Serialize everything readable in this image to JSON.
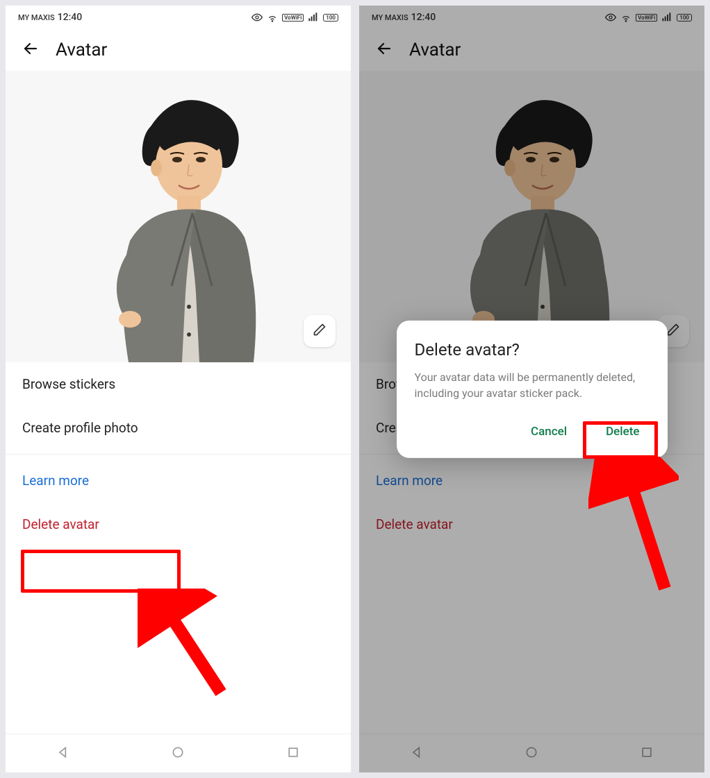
{
  "statusbar": {
    "carrier": "MY MAXIS",
    "time": "12:40",
    "battery": "100"
  },
  "header": {
    "title": "Avatar"
  },
  "options": {
    "browse_stickers": "Browse stickers",
    "create_profile_photo": "Create profile photo",
    "learn_more": "Learn more",
    "delete_avatar": "Delete avatar"
  },
  "dialog": {
    "title": "Delete avatar?",
    "body": "Your avatar data will be permanently deleted, including your avatar sticker pack.",
    "cancel": "Cancel",
    "confirm": "Delete"
  },
  "icons": {
    "vowifi": "VoWiFi"
  }
}
